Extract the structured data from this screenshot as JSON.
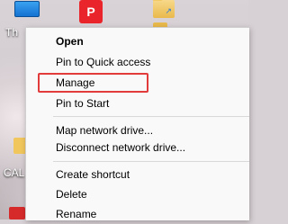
{
  "desktop": {
    "this_pc_label": "Th",
    "cal_label": "CAL",
    "red_app_glyph": "P",
    "folder_mark": "↗"
  },
  "context_menu": {
    "items": [
      {
        "label": "Open",
        "bold": true
      },
      {
        "label": "Pin to Quick access"
      },
      {
        "label": "Manage",
        "highlighted": true
      },
      {
        "label": "Pin to Start"
      },
      {
        "label": "Map network drive..."
      },
      {
        "label": "Disconnect network drive..."
      },
      {
        "label": "Create shortcut"
      },
      {
        "label": "Delete"
      },
      {
        "label": "Rename"
      }
    ],
    "highlight_color": "#e23b3b"
  }
}
